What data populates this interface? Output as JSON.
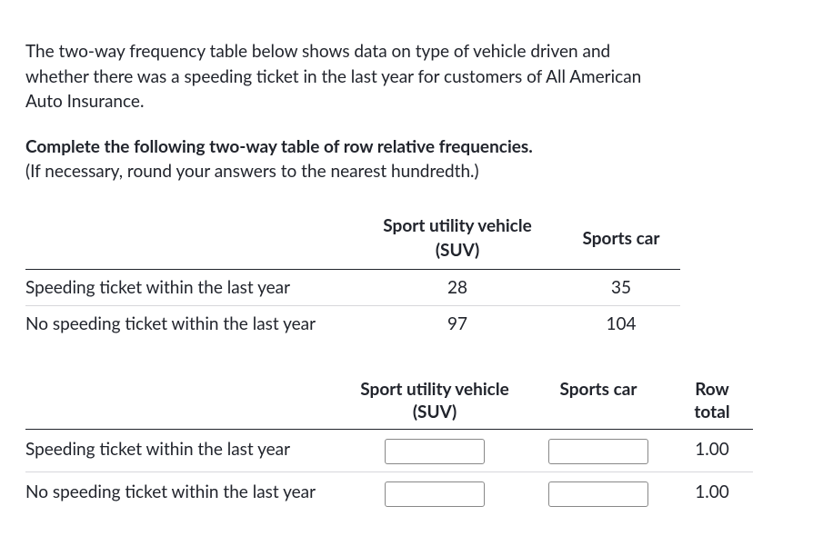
{
  "intro": "The two-way frequency table below shows data on type of vehicle driven and whether there was a speeding ticket in the last year for customers of All American Auto Insurance.",
  "prompt_bold": "Complete the following two-way table of row relative frequencies.",
  "prompt_note": "(If necessary, round your answers to the nearest hundredth.)",
  "table1": {
    "col1": "Sport utility vehicle (SUV)",
    "col2": "Sports car",
    "rows": [
      {
        "label": "Speeding ticket within the last year",
        "v1": "28",
        "v2": "35"
      },
      {
        "label": "No speeding ticket within the last year",
        "v1": "97",
        "v2": "104"
      }
    ]
  },
  "table2": {
    "col1a": "Sport utility vehicle",
    "col1b": "(SUV)",
    "col2": "Sports car",
    "col3a": "Row",
    "col3b": "total",
    "rows": [
      {
        "label": "Speeding ticket within the last year",
        "v1": "",
        "v2": "",
        "total": "1.00"
      },
      {
        "label": "No speeding ticket within the last year",
        "v1": "",
        "v2": "",
        "total": "1.00"
      }
    ]
  },
  "chart_data": {
    "type": "table",
    "title": "Vehicle type vs speeding ticket (last year), All American Auto Insurance customers",
    "columns": [
      "Sport utility vehicle (SUV)",
      "Sports car"
    ],
    "rows": [
      "Speeding ticket within the last year",
      "No speeding ticket within the last year"
    ],
    "values": [
      [
        28,
        35
      ],
      [
        97,
        104
      ]
    ],
    "row_relative_totals": [
      1.0,
      1.0
    ]
  }
}
